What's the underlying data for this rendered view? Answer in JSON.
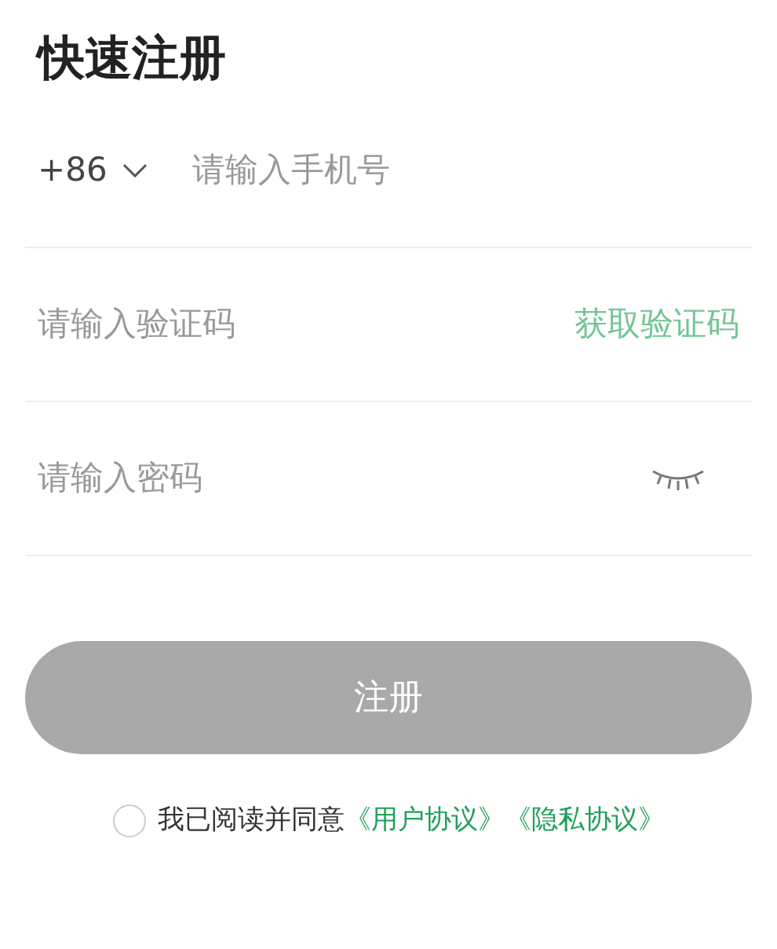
{
  "title": "快速注册",
  "phone": {
    "country_code": "+86",
    "placeholder": "请输入手机号"
  },
  "code": {
    "placeholder": "请输入验证码",
    "action": "获取验证码"
  },
  "password": {
    "placeholder": "请输入密码",
    "visible": false
  },
  "submit": {
    "label": "注册",
    "disabled": true
  },
  "agreement": {
    "checked": false,
    "text": "我已阅读并同意",
    "links": [
      "《用户协议》",
      "《隐私协议》"
    ]
  }
}
